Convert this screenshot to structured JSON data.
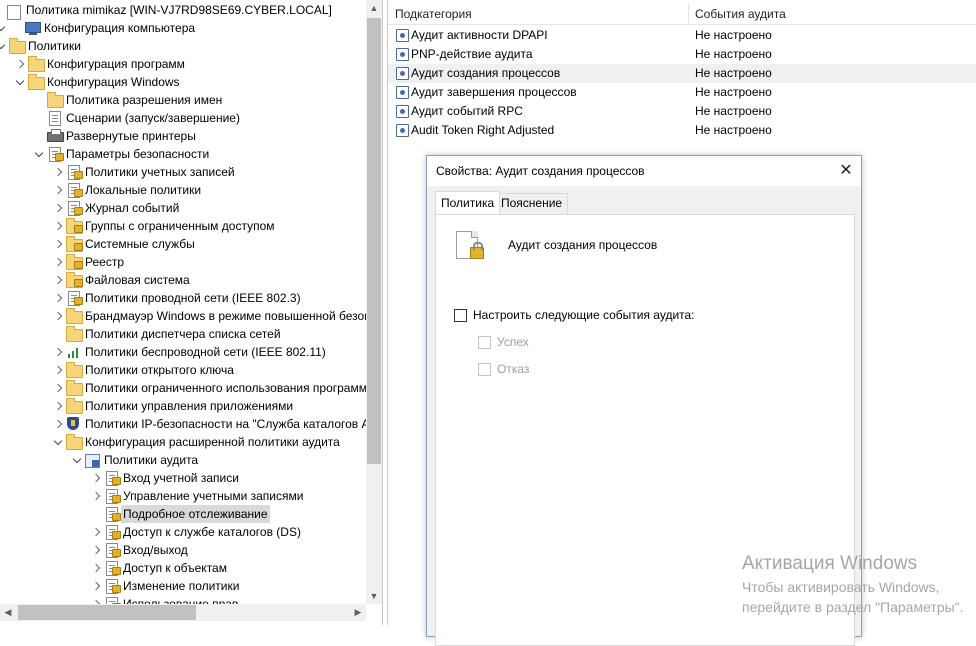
{
  "tree": {
    "items": [
      {
        "label": "Политика mimikaz [WIN-VJ7RD98SE69.CYBER.LOCAL]",
        "icon": "policy-doc-icon",
        "level": 0,
        "exp": "none"
      },
      {
        "label": "Конфигурация компьютера",
        "icon": "computer-icon",
        "level": 0,
        "exp": "open"
      },
      {
        "label": "Политики",
        "icon": "folder-icon",
        "level": 1,
        "exp": "open"
      },
      {
        "label": "Конфигурация программ",
        "icon": "folder-icon",
        "level": 2,
        "exp": "closed"
      },
      {
        "label": "Конфигурация Windows",
        "icon": "folder-icon",
        "level": 2,
        "exp": "open"
      },
      {
        "label": "Политика разрешения имен",
        "icon": "folder-icon",
        "level": 3,
        "exp": "none"
      },
      {
        "label": "Сценарии (запуск/завершение)",
        "icon": "script-icon",
        "level": 3,
        "exp": "none"
      },
      {
        "label": "Развернутые принтеры",
        "icon": "printer-icon",
        "level": 3,
        "exp": "none"
      },
      {
        "label": "Параметры безопасности",
        "icon": "security-settings-icon",
        "level": 3,
        "exp": "open"
      },
      {
        "label": "Политики учетных записей",
        "icon": "security-settings-icon",
        "level": 4,
        "exp": "closed"
      },
      {
        "label": "Локальные политики",
        "icon": "security-settings-icon",
        "level": 4,
        "exp": "closed"
      },
      {
        "label": "Журнал событий",
        "icon": "security-settings-icon",
        "level": 4,
        "exp": "closed"
      },
      {
        "label": "Группы с ограниченным доступом",
        "icon": "locked-folder-icon",
        "level": 4,
        "exp": "closed"
      },
      {
        "label": "Системные службы",
        "icon": "locked-folder-icon",
        "level": 4,
        "exp": "closed"
      },
      {
        "label": "Реестр",
        "icon": "locked-folder-icon",
        "level": 4,
        "exp": "closed"
      },
      {
        "label": "Файловая система",
        "icon": "locked-folder-icon",
        "level": 4,
        "exp": "closed"
      },
      {
        "label": "Политики проводной сети (IEEE 802.3)",
        "icon": "security-settings-icon",
        "level": 4,
        "exp": "closed"
      },
      {
        "label": "Брандмауэр Windows в режиме повышенной безопасности",
        "icon": "folder-icon",
        "level": 4,
        "exp": "closed"
      },
      {
        "label": "Политики диспетчера списка сетей",
        "icon": "folder-icon",
        "level": 4,
        "exp": "none"
      },
      {
        "label": "Политики беспроводной сети (IEEE 802.11)",
        "icon": "wireless-chart-icon",
        "level": 4,
        "exp": "closed"
      },
      {
        "label": "Политики открытого ключа",
        "icon": "folder-icon",
        "level": 4,
        "exp": "closed"
      },
      {
        "label": "Политики ограниченного использования программ",
        "icon": "folder-icon",
        "level": 4,
        "exp": "closed"
      },
      {
        "label": "Политики управления приложениями",
        "icon": "folder-icon",
        "level": 4,
        "exp": "closed"
      },
      {
        "label": "Политики IP-безопасности на \"Служба каталогов Active Directory\"",
        "icon": "ipsec-shield-icon",
        "level": 4,
        "exp": "closed"
      },
      {
        "label": "Конфигурация расширенной политики аудита",
        "icon": "folder-icon",
        "level": 4,
        "exp": "open"
      },
      {
        "label": "Политики аудита",
        "icon": "audit-policy-icon",
        "level": 5,
        "exp": "open"
      },
      {
        "label": "Вход учетной записи",
        "icon": "security-settings-icon",
        "level": 6,
        "exp": "closed"
      },
      {
        "label": "Управление учетными записями",
        "icon": "security-settings-icon",
        "level": 6,
        "exp": "closed"
      },
      {
        "label": "Подробное отслеживание",
        "icon": "security-settings-icon",
        "level": 6,
        "exp": "none",
        "selected": true
      },
      {
        "label": "Доступ к службе каталогов (DS)",
        "icon": "security-settings-icon",
        "level": 6,
        "exp": "closed"
      },
      {
        "label": "Вход/выход",
        "icon": "security-settings-icon",
        "level": 6,
        "exp": "closed"
      },
      {
        "label": "Доступ к объектам",
        "icon": "security-settings-icon",
        "level": 6,
        "exp": "closed"
      },
      {
        "label": "Изменение политики",
        "icon": "security-settings-icon",
        "level": 6,
        "exp": "closed"
      },
      {
        "label": "Использование прав",
        "icon": "security-settings-icon",
        "level": 6,
        "exp": "closed"
      }
    ]
  },
  "list": {
    "col_subcategory": "Подкатегория",
    "col_audit_events": "События аудита",
    "rows": [
      {
        "subcategory": "Аудит активности DPAPI",
        "value": "Не настроено"
      },
      {
        "subcategory": "PNP-действие аудита",
        "value": "Не настроено"
      },
      {
        "subcategory": "Аудит создания процессов",
        "value": "Не настроено",
        "highlight": true
      },
      {
        "subcategory": "Аудит завершения процессов",
        "value": "Не настроено"
      },
      {
        "subcategory": "Аудит событий RPC",
        "value": "Не настроено"
      },
      {
        "subcategory": "Audit Token Right Adjusted",
        "value": "Не настроено"
      }
    ]
  },
  "dialog": {
    "title": "Свойства: Аудит создания процессов",
    "tabs": [
      "Политика",
      "Пояснение"
    ],
    "active_tab": "Политика",
    "policy_name": "Аудит создания процессов",
    "configure_label": "Настроить следующие события аудита:",
    "configure_checked": false,
    "success_label": "Успех",
    "failure_label": "Отказ"
  },
  "activation": {
    "title": "Активация Windows",
    "text_line1": "Чтобы активировать Windows,",
    "text_line2": "перейдите в раздел \"Параметры\"."
  }
}
